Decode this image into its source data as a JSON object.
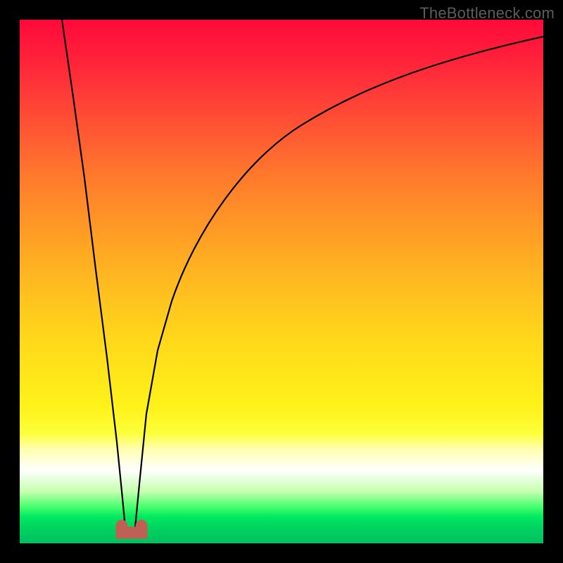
{
  "watermark": "TheBottleneck.com",
  "gradient_colors": {
    "top": "#ff0a3a",
    "mid": "#ffda1a",
    "bottom": "#00c060"
  },
  "curve_color": "#000000",
  "bracket_color": "#c06055",
  "chart_data": {
    "type": "line",
    "title": "",
    "xlabel": "",
    "ylabel": "",
    "xlim": [
      0,
      100
    ],
    "ylim": [
      0,
      100
    ],
    "grid": false,
    "legend": false,
    "series": [
      {
        "name": "bottleneck-curve",
        "x": [
          8,
          10,
          12,
          14,
          16,
          18,
          19,
          20,
          21,
          22,
          24,
          26,
          30,
          35,
          40,
          45,
          50,
          55,
          60,
          70,
          80,
          90,
          100
        ],
        "y": [
          100,
          83,
          67,
          50,
          33,
          14,
          4,
          0,
          4,
          16,
          34,
          46,
          60,
          70,
          77,
          82,
          85.5,
          88,
          90,
          93,
          95,
          96.5,
          98
        ]
      }
    ],
    "annotations": [
      {
        "name": "vertex-bracket",
        "x_start": 18.5,
        "x_end": 22.5,
        "y": 1
      }
    ],
    "notes": "y = bottleneck percentage (background encodes same scale: 100=red top, 0=green bottom). Minimum near x≈20."
  }
}
